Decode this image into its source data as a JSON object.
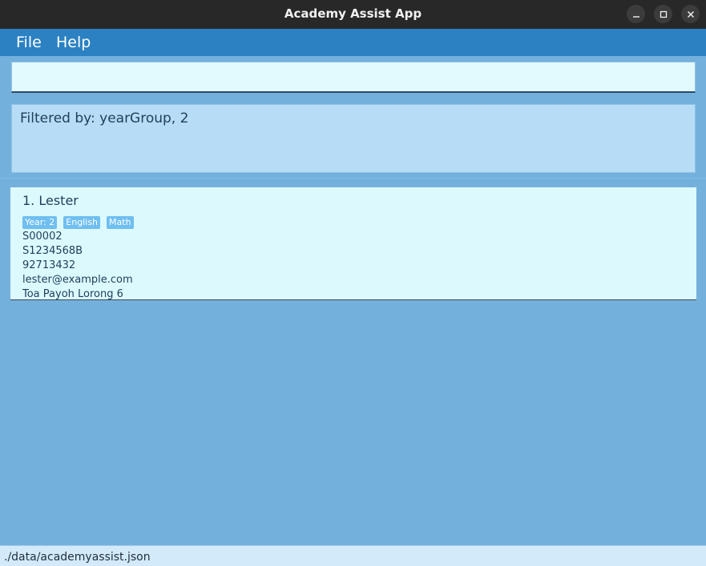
{
  "window": {
    "title": "Academy Assist App",
    "controls": [
      "minimize-icon",
      "maximize-icon",
      "close-icon"
    ]
  },
  "menu": {
    "file_label": "File",
    "help_label": "Help"
  },
  "command": {
    "value": "",
    "placeholder": ""
  },
  "result": {
    "text": "Filtered by: yearGroup, 2"
  },
  "students": [
    {
      "name": "1. Lester",
      "tags": [
        "Year: 2",
        "English",
        "Math"
      ],
      "student_id": "S00002",
      "nric": "S1234568B",
      "phone": "92713432",
      "email": "lester@example.com",
      "address": "Toa Payoh Lorong 6"
    }
  ],
  "status": {
    "file_path": "./data/academyassist.json"
  },
  "colors": {
    "titlebar": "#282828",
    "menubar": "#2b81c2",
    "background": "#74b0dc",
    "command_box": "#e2f9fe",
    "result_box": "#b7dcf6",
    "card": "#dcf9fe",
    "tag": "#6fbff0",
    "statusbar": "#d3eafb"
  }
}
